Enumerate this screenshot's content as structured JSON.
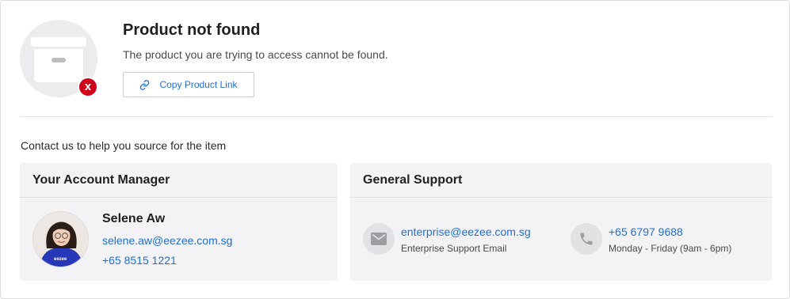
{
  "status": {
    "title": "Product not found",
    "message": "The product you are trying to access cannot be found.",
    "copy_button_label": "Copy Product Link",
    "badge_glyph": "x",
    "illustration_icon": "empty-box-icon",
    "error_color": "#d0021b",
    "link_color": "#1f6fd1"
  },
  "contact_note": "Contact us to help you source for the item",
  "account_manager": {
    "heading": "Your Account Manager",
    "name": "Selene Aw",
    "email": "selene.aw@eezee.com.sg",
    "phone": "+65 8515 1221",
    "shirt_text": "eezee"
  },
  "general_support": {
    "heading": "General Support",
    "email": "enterprise@eezee.com.sg",
    "email_caption": "Enterprise Support Email",
    "phone": "+65 6797 9688",
    "phone_caption": "Monday - Friday (9am - 6pm)"
  }
}
